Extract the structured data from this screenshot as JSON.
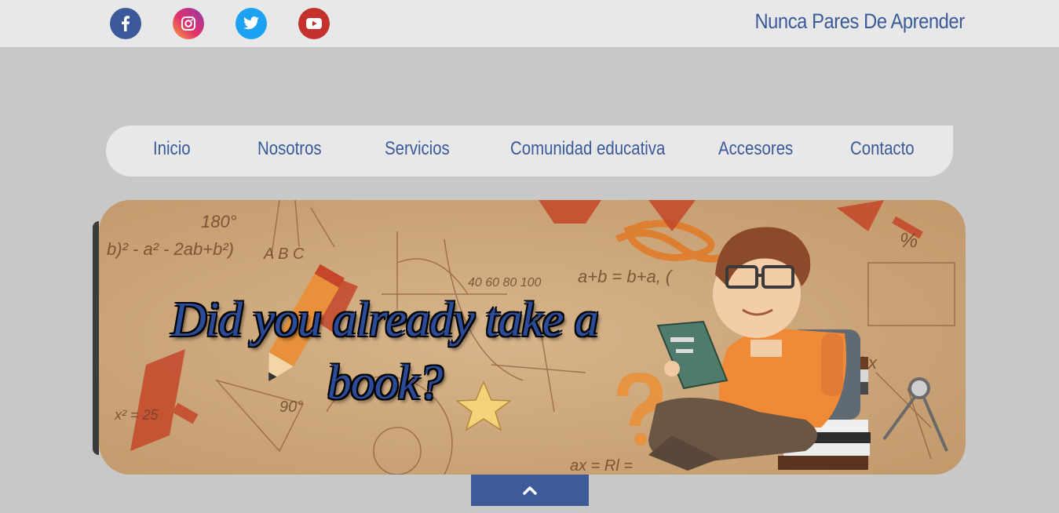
{
  "header": {
    "brand_text": "Nunca Pares De Aprender",
    "social": [
      {
        "icon": "facebook-icon",
        "color": "#3b5998"
      },
      {
        "icon": "instagram-icon",
        "color": "#d62976"
      },
      {
        "icon": "twitter-icon",
        "color": "#1da1f2"
      },
      {
        "icon": "youtube-icon",
        "color": "#c4302b"
      }
    ]
  },
  "nav": {
    "items": [
      {
        "label": "Inicio"
      },
      {
        "label": "Nosotros"
      },
      {
        "label": "Servicios"
      },
      {
        "label": "Comunidad educativa"
      },
      {
        "label": "Accesores"
      },
      {
        "label": "Contacto"
      }
    ]
  },
  "banner": {
    "headline": "Did you already take a book?"
  },
  "back_to_top": {
    "icon": "chevron-up-icon"
  }
}
